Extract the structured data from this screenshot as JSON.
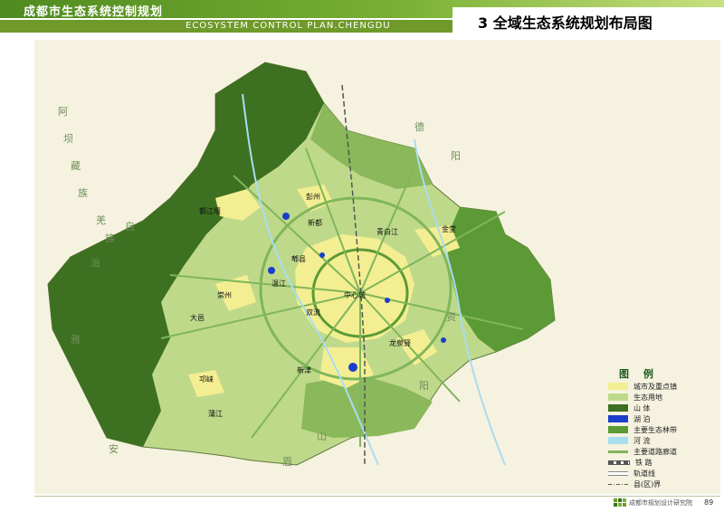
{
  "header": {
    "doc_title": "成都市生态系统控制规划",
    "english_title": "ECOSYSTEM CONTROL PLAN.CHENGDU",
    "map_title": "3 全域生态系统规划布局图"
  },
  "colors": {
    "urban": "#f4ee92",
    "eco_land": "#bfd98b",
    "mountain": "#3d7020",
    "lake": "#1a3fc8",
    "forest_belt": "#5b9a35",
    "river": "#a9ddf0",
    "road": "#7fb65a",
    "boundary": "#555555"
  },
  "legend": {
    "title": "图 例",
    "items": [
      {
        "label": "城市及重点镇",
        "color": "#f4ee92",
        "kind": "fill"
      },
      {
        "label": "生态用地",
        "color": "#bfd98b",
        "kind": "fill"
      },
      {
        "label": "山 体",
        "color": "#3d7020",
        "kind": "fill"
      },
      {
        "label": "湖 泊",
        "color": "#1a3fc8",
        "kind": "fill"
      },
      {
        "label": "主要生态林带",
        "color": "#5b9a35",
        "kind": "fill"
      },
      {
        "label": "河 流",
        "color": "#a9ddf0",
        "kind": "fill"
      },
      {
        "label": "主要道路廊道",
        "color": "#7fb65a",
        "kind": "line"
      },
      {
        "label": "铁 路",
        "color": "#555555",
        "kind": "rail"
      },
      {
        "label": "轨道线",
        "color": "#888888",
        "kind": "double"
      },
      {
        "label": "县(区)界",
        "color": "#555555",
        "kind": "dash"
      }
    ]
  },
  "places": [
    {
      "name": "都江堰"
    },
    {
      "name": "彭州"
    },
    {
      "name": "新都"
    },
    {
      "name": "青白江"
    },
    {
      "name": "金堂"
    },
    {
      "name": "郫县"
    },
    {
      "name": "温江"
    },
    {
      "name": "崇州"
    },
    {
      "name": "大邑"
    },
    {
      "name": "中心城"
    },
    {
      "name": "双流"
    },
    {
      "name": "龙泉驿"
    },
    {
      "name": "邛崃"
    },
    {
      "name": "新津"
    },
    {
      "name": "蒲江"
    }
  ],
  "surroundings": [
    {
      "name": "阿"
    },
    {
      "name": "坝"
    },
    {
      "name": "藏"
    },
    {
      "name": "族"
    },
    {
      "name": "羌"
    },
    {
      "name": "族"
    },
    {
      "name": "自"
    },
    {
      "name": "治"
    },
    {
      "name": "德"
    },
    {
      "name": "阳"
    },
    {
      "name": "资"
    },
    {
      "name": "阳"
    },
    {
      "name": "眉"
    },
    {
      "name": "山"
    },
    {
      "name": "雅"
    },
    {
      "name": "安"
    }
  ],
  "footer": {
    "org": "成都市规划设计研究院",
    "page": "89"
  }
}
